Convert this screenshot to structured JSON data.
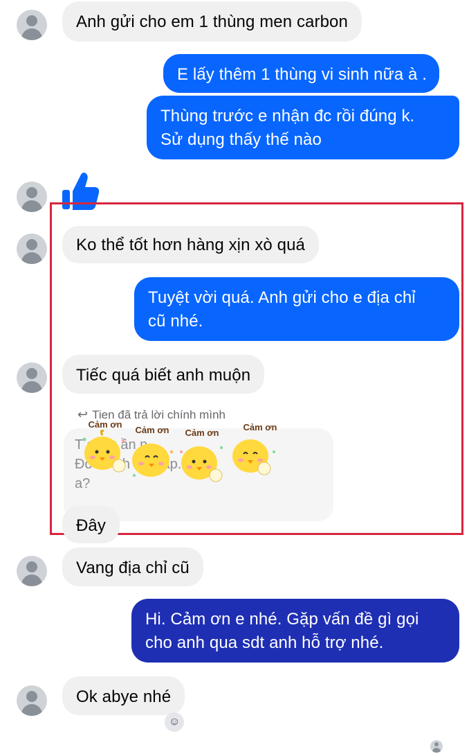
{
  "messages": [
    {
      "from": "them",
      "text": "Anh gửi cho em 1 thùng men carbon"
    },
    {
      "from": "me",
      "text": "E lấy thêm 1 thùng vi sinh nữa à ."
    },
    {
      "from": "me",
      "lines": [
        "Thùng trước e nhận đc rồi đúng k.",
        "Sử dụng thấy thế nào"
      ]
    },
    {
      "from": "them",
      "type": "like",
      "icon": "thumbs-up-icon"
    },
    {
      "from": "them",
      "text": "Ko thể tốt hơn hàng xịn xò quá"
    },
    {
      "from": "me",
      "lines": [
        "Tuyệt vời quá. Anh gửi cho e địa chỉ",
        "cũ nhé."
      ]
    },
    {
      "from": "them",
      "text": "Tiếc quá biết anh muộn"
    },
    {
      "from": "them",
      "text": "Đây"
    },
    {
      "from": "them",
      "text": "Vang địa chỉ cũ"
    },
    {
      "from": "me",
      "lines": [
        "Hi. Cảm ơn e nhé. Gặp vấn đề gì gọi",
        "cho anh qua sdt anh hỗ trợ nhé."
      ]
    },
    {
      "from": "them",
      "text": "Ok abye nhé"
    }
  ],
  "reply": {
    "note": "Tien đã trả lời chính mình",
    "quote_lines": [
      "T      o          hiu    ần       n",
      "Đo     ch         nh     đơn       ap.ok",
      "a?"
    ]
  },
  "sticker": {
    "caption": "Cảm ơn",
    "count": 4
  },
  "colors": {
    "outgoing": "#0866ff",
    "outgoing_last": "#1f2fb4",
    "incoming": "#f0f0f0",
    "highlight_frame": "#d7263d"
  }
}
